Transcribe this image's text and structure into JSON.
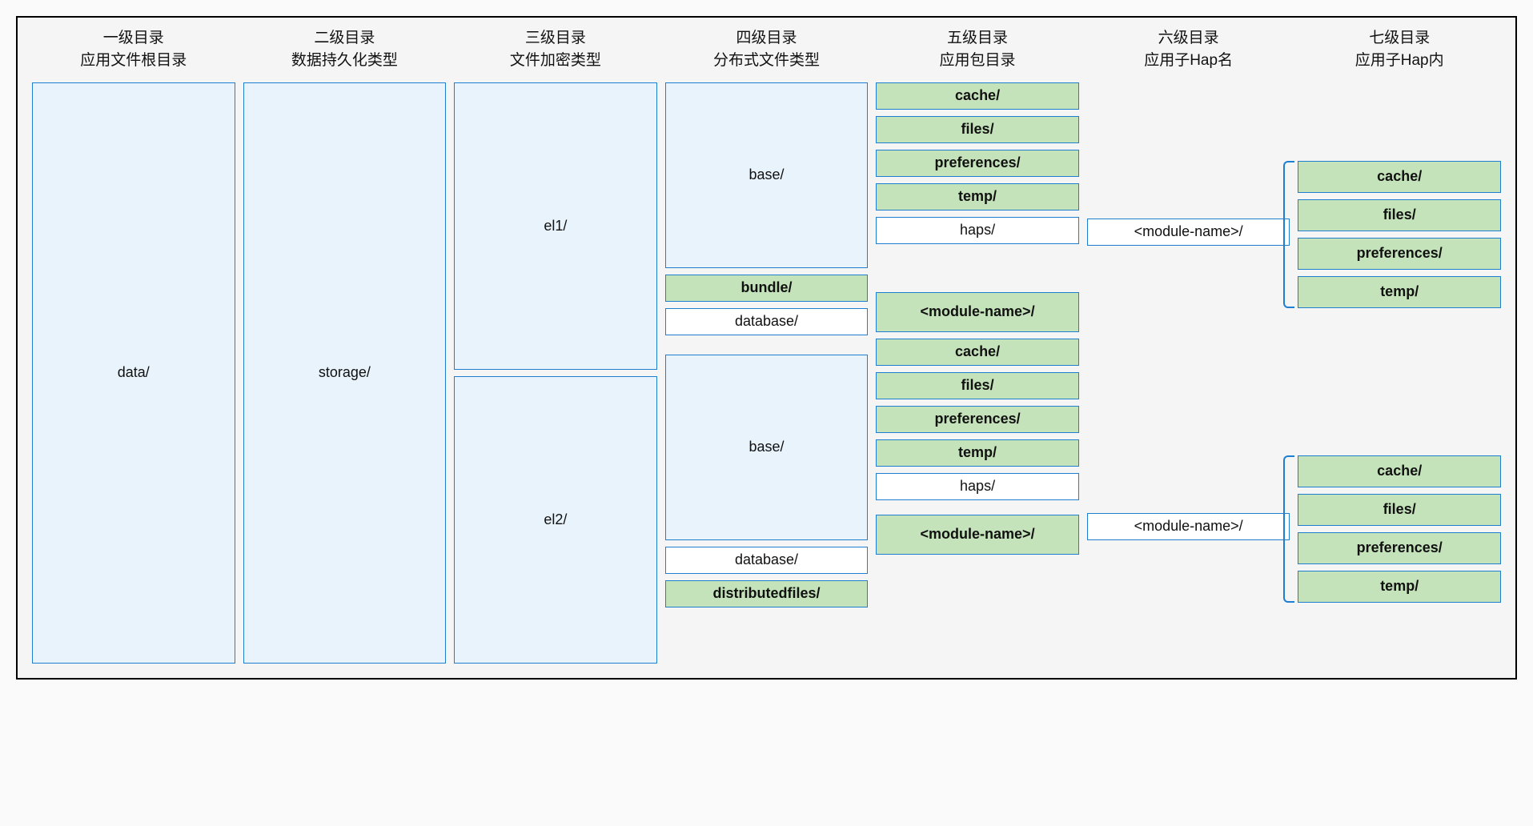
{
  "headers": {
    "l1a": "一级目录",
    "l1b": "应用文件根目录",
    "l2a": "二级目录",
    "l2b": "数据持久化类型",
    "l3a": "三级目录",
    "l3b": "文件加密类型",
    "l4a": "四级目录",
    "l4b": "分布式文件类型",
    "l5a": "五级目录",
    "l5b": "应用包目录",
    "l6a": "六级目录",
    "l6b": "应用子Hap名",
    "l7a": "七级目录",
    "l7b": "应用子Hap内"
  },
  "col1": {
    "data": "data/"
  },
  "col2": {
    "storage": "storage/"
  },
  "col3": {
    "el1": "el1/",
    "el2": "el2/"
  },
  "col4": {
    "base1": "base/",
    "bundle": "bundle/",
    "database1": "database/",
    "base2": "base/",
    "database2": "database/",
    "distributedfiles": "distributedfiles/"
  },
  "col5": {
    "cache1": "cache/",
    "files1": "files/",
    "prefs1": "preferences/",
    "temp1": "temp/",
    "haps1": "haps/",
    "mod1": "<module-name>/",
    "cache2": "cache/",
    "files2": "files/",
    "prefs2": "preferences/",
    "temp2": "temp/",
    "haps2": "haps/",
    "mod2": "<module-name>/"
  },
  "col6": {
    "mod1": "<module-name>/",
    "mod2": "<module-name>/"
  },
  "col7": {
    "cache1": "cache/",
    "files1": "files/",
    "prefs1": "preferences/",
    "temp1": "temp/",
    "cache2": "cache/",
    "files2": "files/",
    "prefs2": "preferences/",
    "temp2": "temp/"
  }
}
